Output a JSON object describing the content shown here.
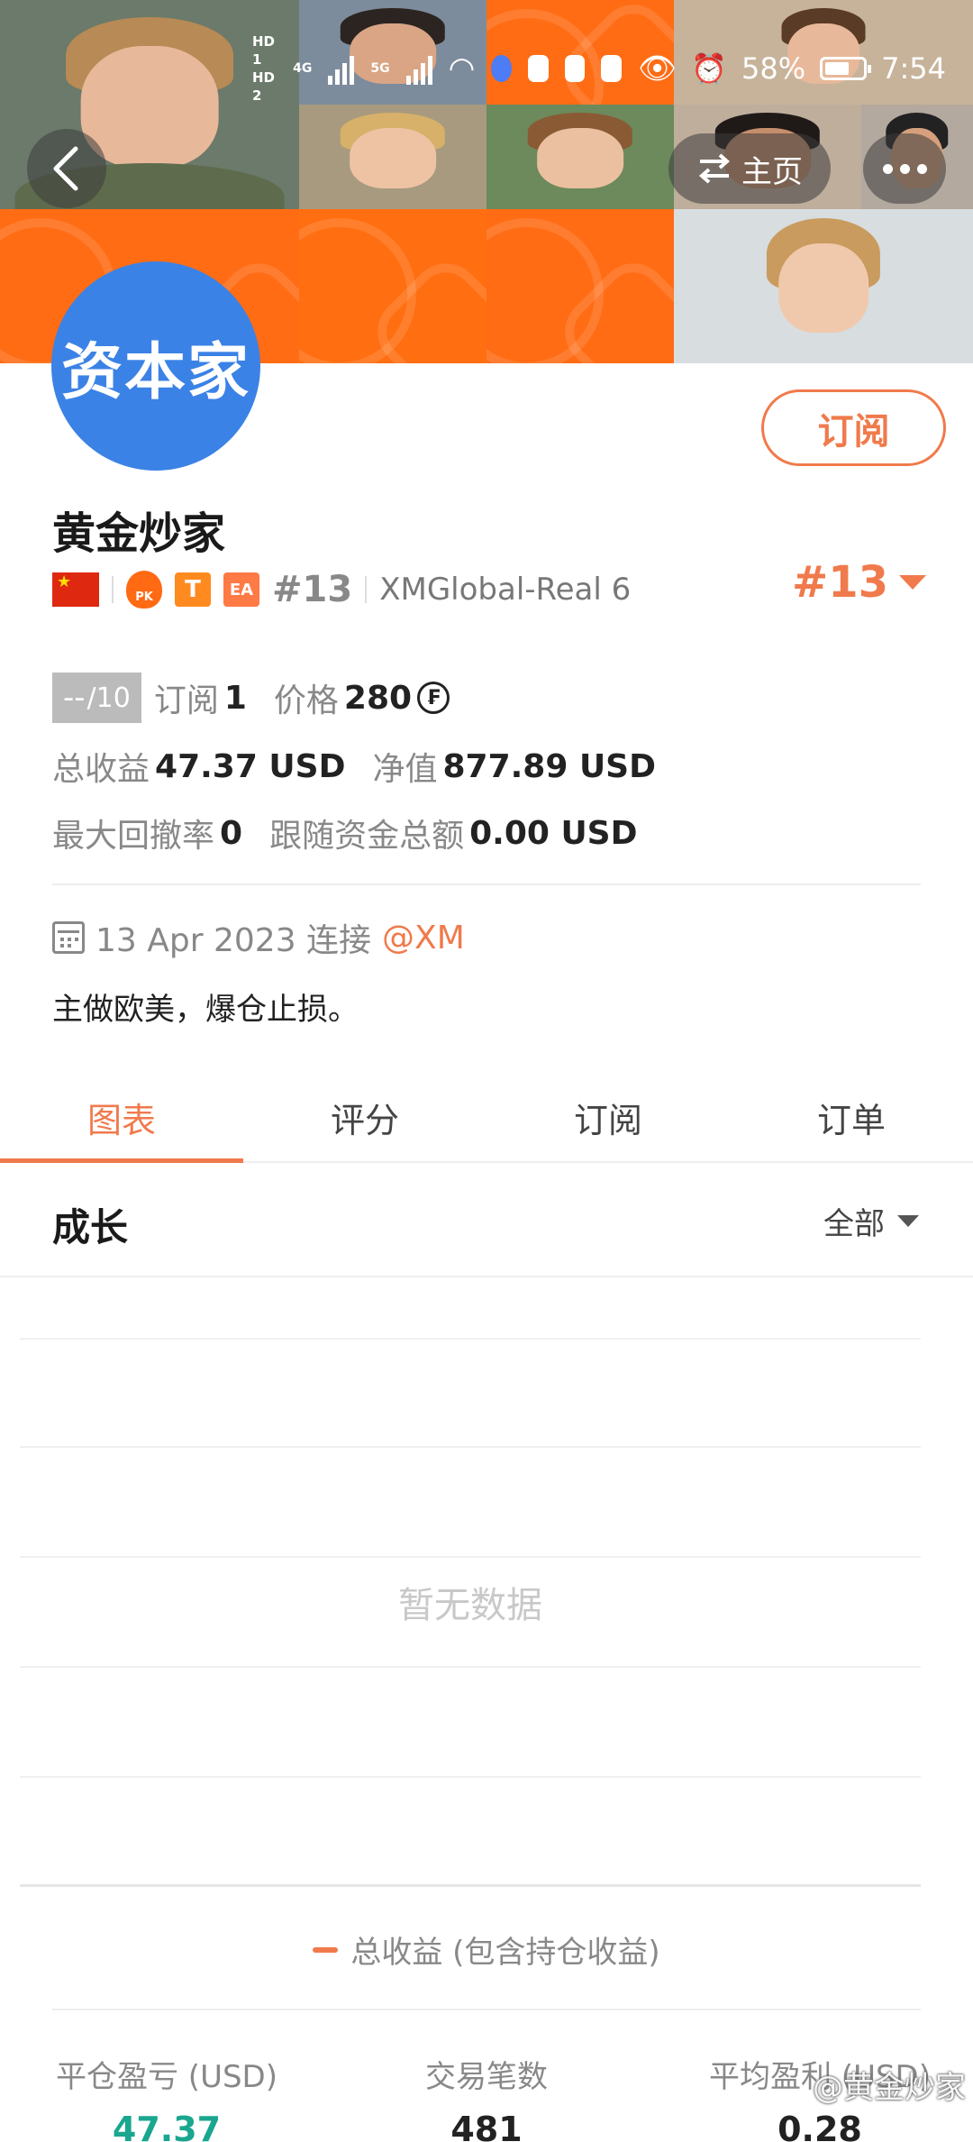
{
  "status_bar": {
    "sim1": "HD 1",
    "sim2": "HD 2",
    "net1": "4G",
    "net2": "5G",
    "battery": "58%",
    "time": "7:54"
  },
  "header": {
    "home_label": "主页"
  },
  "profile": {
    "avatar_text": "资本家",
    "subscribe_label": "订阅",
    "name": "黄金炒家",
    "badge_pk": "PK",
    "badge_t": "T",
    "badge_ea": "EA",
    "rank_small": "#13",
    "broker": "XMGlobal-Real 6",
    "rank_big": "#13"
  },
  "stats": {
    "score": "--",
    "score_max": "/10",
    "subscribe_label": "订阅",
    "subscribe_count": "1",
    "price_label": "价格",
    "price_value": "280",
    "price_currency_icon": "coin-icon",
    "total_profit_label": "总收益",
    "total_profit_value": "47.37 USD",
    "equity_label": "净值",
    "equity_value": "877.89 USD",
    "drawdown_label": "最大回撤率",
    "drawdown_value": "0",
    "follow_funds_label": "跟随资金总额",
    "follow_funds_value": "0.00 USD"
  },
  "connection": {
    "date": "13 Apr 2023 连接",
    "broker_tag": "@XM"
  },
  "bio": "主做欧美，爆仓止损。",
  "tabs": [
    {
      "label": "图表",
      "active": true
    },
    {
      "label": "评分",
      "active": false
    },
    {
      "label": "订阅",
      "active": false
    },
    {
      "label": "订单",
      "active": false
    }
  ],
  "growth": {
    "title": "成长",
    "filter": "全部",
    "empty_text": "暂无数据",
    "legend": "总收益 (包含持仓收益)"
  },
  "bottom_stats": [
    {
      "label": "平仓盈亏 (USD)",
      "value": "47.37",
      "color": "#1aa68f"
    },
    {
      "label": "交易笔数",
      "value": "481",
      "color": "#222222"
    },
    {
      "label": "平均盈利 (USD)",
      "value": "0.28",
      "color": "#222222"
    }
  ],
  "watermark": "@黄金炒家",
  "colors": {
    "accent": "#f07a4c",
    "banner_orange": "#ff6a13",
    "avatar_blue": "#3b82e6",
    "profit_green": "#1aa68f"
  }
}
